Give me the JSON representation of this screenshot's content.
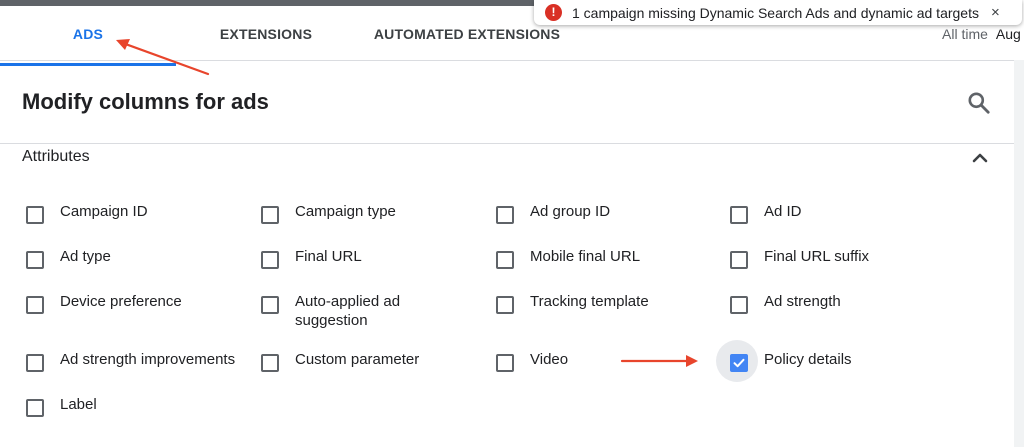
{
  "tabs": [
    {
      "label": "ADS",
      "active": true
    },
    {
      "label": "EXTENSIONS",
      "active": false
    },
    {
      "label": "AUTOMATED EXTENSIONS",
      "active": false
    }
  ],
  "toast": {
    "icon": "!",
    "message": "1 campaign missing Dynamic Search Ads and dynamic ad targets",
    "close": "×"
  },
  "date_range": {
    "label": "All time",
    "month": "Aug"
  },
  "header": {
    "title": "Modify columns for ads"
  },
  "section": {
    "title": "Attributes",
    "expanded": true
  },
  "options": [
    {
      "label": "Campaign ID",
      "checked": false
    },
    {
      "label": "Campaign type",
      "checked": false
    },
    {
      "label": "Ad group ID",
      "checked": false
    },
    {
      "label": "Ad ID",
      "checked": false
    },
    {
      "label": "Ad type",
      "checked": false
    },
    {
      "label": "Final URL",
      "checked": false
    },
    {
      "label": "Mobile final URL",
      "checked": false
    },
    {
      "label": "Final URL suffix",
      "checked": false
    },
    {
      "label": "Device preference",
      "checked": false
    },
    {
      "label": "Auto-applied ad suggestion",
      "checked": false
    },
    {
      "label": "Tracking template",
      "checked": false
    },
    {
      "label": "Ad strength",
      "checked": false
    },
    {
      "label": "Ad strength improvements",
      "checked": false
    },
    {
      "label": "Custom parameter",
      "checked": false
    },
    {
      "label": "Video",
      "checked": false
    },
    {
      "label": "Policy details",
      "checked": true
    },
    {
      "label": "Label",
      "checked": false
    }
  ],
  "colors": {
    "accent": "#1a73e8",
    "checkbox_checked": "#4285f4",
    "annotation": "#e8452c",
    "error": "#d93025"
  }
}
